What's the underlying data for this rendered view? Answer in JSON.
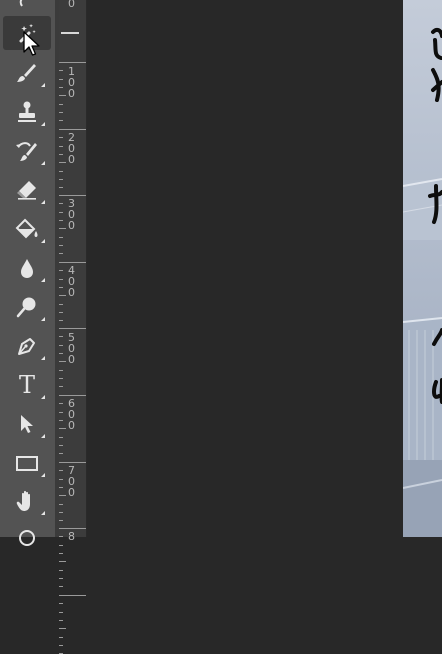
{
  "toolbar": {
    "tools": [
      {
        "name": "magic-wand-tool",
        "icon": "magic-wand-icon",
        "active": true
      },
      {
        "name": "brush-tool",
        "icon": "brush-icon"
      },
      {
        "name": "clone-stamp-tool",
        "icon": "stamp-icon"
      },
      {
        "name": "history-brush-tool",
        "icon": "history-brush-icon"
      },
      {
        "name": "eraser-tool",
        "icon": "eraser-icon"
      },
      {
        "name": "paint-bucket-tool",
        "icon": "paint-bucket-icon"
      },
      {
        "name": "blur-tool",
        "icon": "drop-icon"
      },
      {
        "name": "dodge-tool",
        "icon": "dodge-icon"
      },
      {
        "name": "pen-tool",
        "icon": "pen-icon"
      },
      {
        "name": "type-tool",
        "icon": "type-icon",
        "label": "T"
      },
      {
        "name": "path-selection-tool",
        "icon": "arrow-icon"
      },
      {
        "name": "rectangle-tool",
        "icon": "rectangle-icon"
      },
      {
        "name": "hand-tool",
        "icon": "hand-icon"
      },
      {
        "name": "rotate-view-tool",
        "icon": "rotate-view-icon"
      }
    ]
  },
  "ruler": {
    "labels": [
      "0",
      "100",
      "200",
      "300",
      "400",
      "500",
      "600",
      "700",
      "8"
    ]
  },
  "colors": {
    "toolbar": "#535353",
    "ruler": "#3c3c3c",
    "pasteboard": "#282828",
    "icon": "#e6e6e6"
  }
}
